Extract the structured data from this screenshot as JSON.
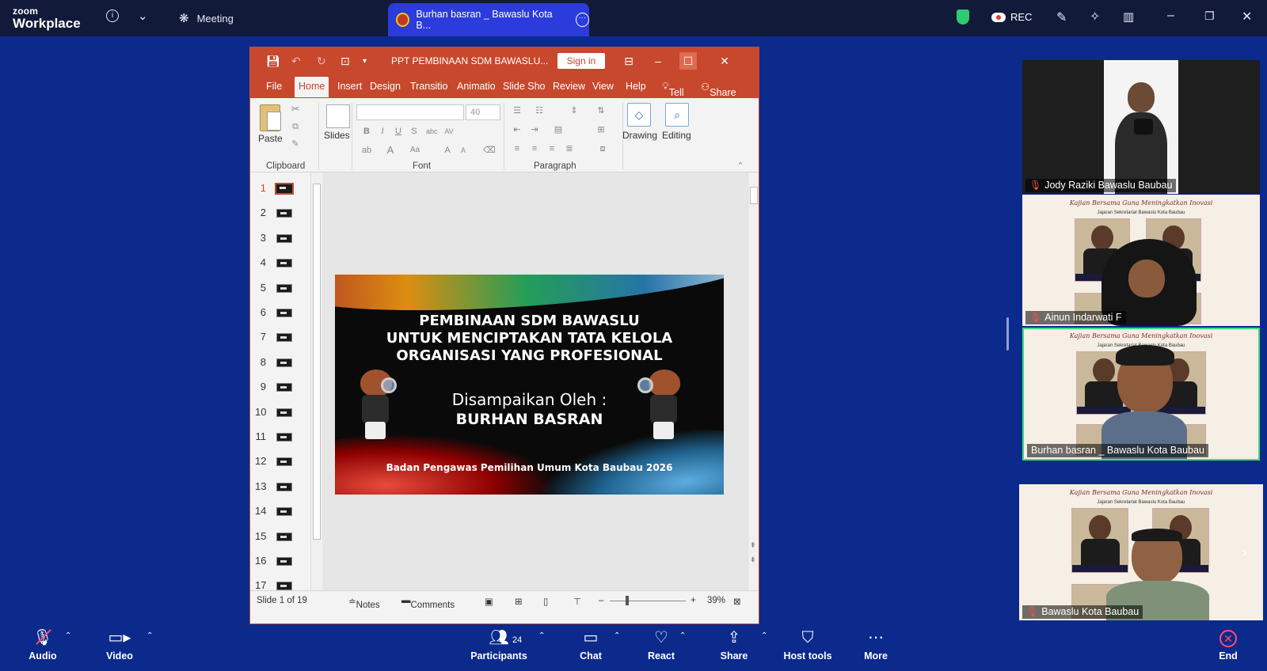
{
  "app": {
    "brand_top": "zoom",
    "brand_bottom": "Workplace"
  },
  "topbar": {
    "info_icon": "info-icon",
    "meeting_label": "Meeting",
    "share_tab_label": "Burhan basran _ Bawaslu Kota B...",
    "rec_label": "REC",
    "colors": {
      "bar_bg": "#121a3a",
      "share_tab": "#2b3bdc",
      "shield": "#2ecc71"
    }
  },
  "ppt": {
    "doc_title": "PPT PEMBINAAN SDM BAWASLU...",
    "signin_label": "Sign in",
    "tabs": [
      "File",
      "Home",
      "Insert",
      "Design",
      "Transitio",
      "Animatio",
      "Slide Sho",
      "Review",
      "View",
      "Help"
    ],
    "tell_me": "Tell me",
    "share": "Share",
    "ribbon": {
      "paste": "Paste",
      "slides": "Slides",
      "font_size": "40",
      "drawing": "Drawing",
      "editing": "Editing",
      "groups": [
        "Clipboard",
        "Font",
        "Paragraph"
      ]
    },
    "thumb_numbers": [
      "1",
      "2",
      "3",
      "4",
      "5",
      "6",
      "7",
      "8",
      "9",
      "10",
      "11",
      "12",
      "13",
      "14",
      "15",
      "16",
      "17"
    ],
    "slide": {
      "title_lines": [
        "PEMBINAAN SDM BAWASLU",
        "UNTUK MENCIPTAKAN TATA KELOLA",
        "ORGANISASI YANG PROFESIONAL"
      ],
      "presented_by": "Disampaikan Oleh :",
      "presenter": "BURHAN BASRAN",
      "footer": "Badan Pengawas Pemilihan Umum Kota Baubau 2026"
    },
    "status": {
      "slide_of": "Slide 1 of 19",
      "notes": "Notes",
      "comments": "Comments",
      "zoom": "39%"
    },
    "colors": {
      "accent": "#c8482d"
    }
  },
  "participants": [
    {
      "name": "Jody Raziki Bawaslu Baubau",
      "muted": true
    },
    {
      "name": "Ainun Indarwati F",
      "muted": true
    },
    {
      "name": "Burhan basran _ Bawaslu Kota Baubau",
      "muted": false,
      "active_speaker": true
    },
    {
      "name": "Bawaslu Kota Baubau",
      "muted": true
    }
  ],
  "poster": {
    "title": "Kajian Bersama Guna Meningkatkan Inovasi",
    "subtitle": "Jajaran Sekretariat Bawaslu Kota Baubau"
  },
  "toolbar": {
    "audio": "Audio",
    "video": "Video",
    "participants": "Participants",
    "participant_count": "24",
    "chat": "Chat",
    "react": "React",
    "share": "Share",
    "host_tools": "Host tools",
    "more": "More",
    "end": "End"
  }
}
